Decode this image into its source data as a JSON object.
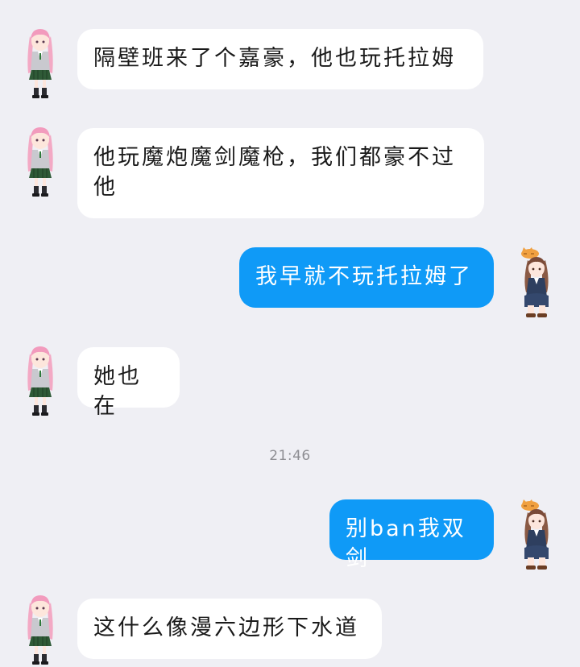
{
  "messages": [
    {
      "side": "in",
      "text": "隔壁班来了个嘉豪，他也玩托拉姆"
    },
    {
      "side": "in",
      "text": "他玩魔炮魔剑魔枪，我们都豪不过他"
    },
    {
      "side": "out",
      "text": "我早就不玩托拉姆了"
    },
    {
      "side": "in",
      "text": "她也在"
    },
    {
      "side": "out",
      "text": "别ban我双剑"
    },
    {
      "side": "in",
      "text": "这什么像漫六边形下水道"
    }
  ],
  "time_divider": "21:46",
  "colors": {
    "background": "#efeff4",
    "incoming_bubble": "#ffffff",
    "outgoing_bubble": "#0f9af7",
    "timestamp": "#8e8e93"
  },
  "icons": {
    "incoming_avatar": "pink-haired-schoolgirl-avatar-icon",
    "outgoing_avatar": "brown-haired-girl-with-cat-avatar-icon"
  }
}
